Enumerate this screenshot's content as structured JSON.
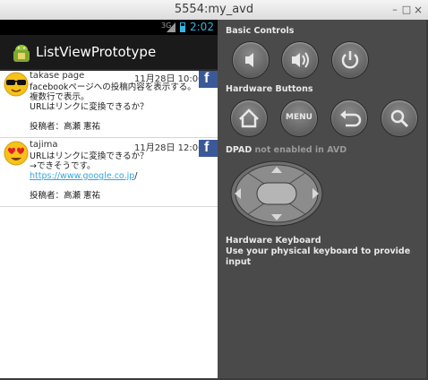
{
  "window": {
    "title": "5554:my_avd"
  },
  "statusbar": {
    "signal_label": "3G",
    "clock": "2:02"
  },
  "app": {
    "title": "ListViewPrototype"
  },
  "posts": [
    {
      "user": "takase page",
      "date": "11月28日 10:00",
      "lines": [
        "facebookページへの投稿内容を表示する。",
        "複数行で表示。",
        "URLはリンクに変換できるか？"
      ],
      "author": "投稿者：高瀬 憲祐"
    },
    {
      "user": "tajima",
      "date": "11月28日 12:00",
      "lines": [
        "URLはリンクに変換できるか？",
        "→できそうです。"
      ],
      "link_text": "https://www.google.co.jp",
      "link_suffix": "/",
      "author": "投稿者：高瀬 憲祐"
    }
  ],
  "panel": {
    "basic_controls_label": "Basic Controls",
    "hardware_buttons_label": "Hardware Buttons",
    "menu_label": "MENU",
    "dpad_label": "DPAD",
    "dpad_note": "not enabled in AVD",
    "keyboard_label": "Hardware Keyboard",
    "keyboard_note": "Use your physical keyboard to provide input"
  },
  "icons": {
    "window": [
      "minimize-icon",
      "maximize-icon",
      "close-icon"
    ],
    "basic": [
      "volume-down-icon",
      "volume-up-icon",
      "power-icon"
    ],
    "hardware": [
      "home-icon",
      "menu-icon",
      "back-icon",
      "search-icon"
    ]
  },
  "colors": {
    "accent": "#33b5e5",
    "facebook": "#3b5998",
    "panel_bg": "#4a4a4a",
    "link": "#33a5dd"
  }
}
